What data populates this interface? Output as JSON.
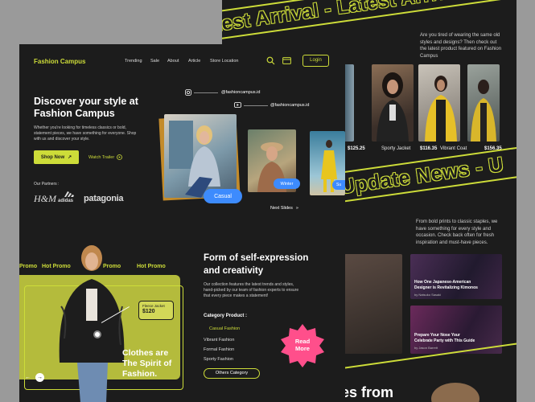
{
  "back": {
    "band_top": "Latest Arrival - Latest Arrival",
    "intro": "Are you tired of wearing the same old styles and designs? Then check out the latest product featured on Fashion Campus",
    "products": [
      {
        "price": "$125.25",
        "name": "Sporty Jacket",
        "price2": "$116.35"
      },
      {
        "name": "Vibrant Coat",
        "price": "$156.35"
      }
    ],
    "band_mid": "Update News - Update News - U",
    "news_intro": "From bold prints to classic staples, we have something for every style and occasion. Check back often for fresh inspiration and must-have pieces.",
    "news": [
      {
        "title": "How One Japanese-American Designer is Revitalizing Kimonos",
        "author": "by Natsuko Sasaki"
      },
      {
        "title": "Prepare Your Nose Your Celebrate Party with This Guide",
        "author": "by Jason Barrett"
      }
    ],
    "bottom_text": "es from"
  },
  "nav": {
    "logo": "Fashion Campus",
    "links": [
      "Trending",
      "Sale",
      "About",
      "Article",
      "Store Location"
    ],
    "login": "Login"
  },
  "hero": {
    "title_l1": "Discover your style at",
    "title_l2": "Fashion Campus",
    "desc": "Whether you're looking for timeless classics or bold, statement pieces, we have something for everyone. Shop with us and discover your style.",
    "shop_now": "Shop Now",
    "shop_arrow": "↗",
    "watch": "Watch Trailer",
    "partners_label": "Our Partners :",
    "partners": [
      "H&M",
      "adidas",
      "patagonia"
    ],
    "instagram": "@fashioncampus.id",
    "youtube": "@fashioncampus.id",
    "pill_casual": "Casual",
    "pill_winter": "Winter",
    "pill_su": "Su",
    "next_slides": "Next Slides",
    "next_arrow": "»"
  },
  "promo": {
    "marquee": [
      "Promo",
      "Hot Promo",
      "Promo",
      "Hot Promo"
    ],
    "item_name": "Fleece Jacket",
    "item_price": "$120",
    "headline_l1": "Clothes are",
    "headline_l2": "The Spirit of",
    "headline_l3": "Fashion."
  },
  "expression": {
    "title_l1": "Form of self-expression",
    "title_l2": "and creativity",
    "desc": "Our collection features the latest trends and styles, hand-picked by our team of fashion experts to ensure that every piece makes a statement!",
    "category_label": "Category Product :",
    "categories": [
      "Casual Fashion",
      "Vibrant Fashion",
      "Formal Fashion",
      "Sporty Fashion"
    ],
    "other_btn": "Others Category",
    "read_more_l1": "Read",
    "read_more_l2": "More"
  },
  "colors": {
    "accent": "#cddc39",
    "bg": "#1c1c1c",
    "blue": "#3d8bfd",
    "pink": "#ff4f8b"
  }
}
